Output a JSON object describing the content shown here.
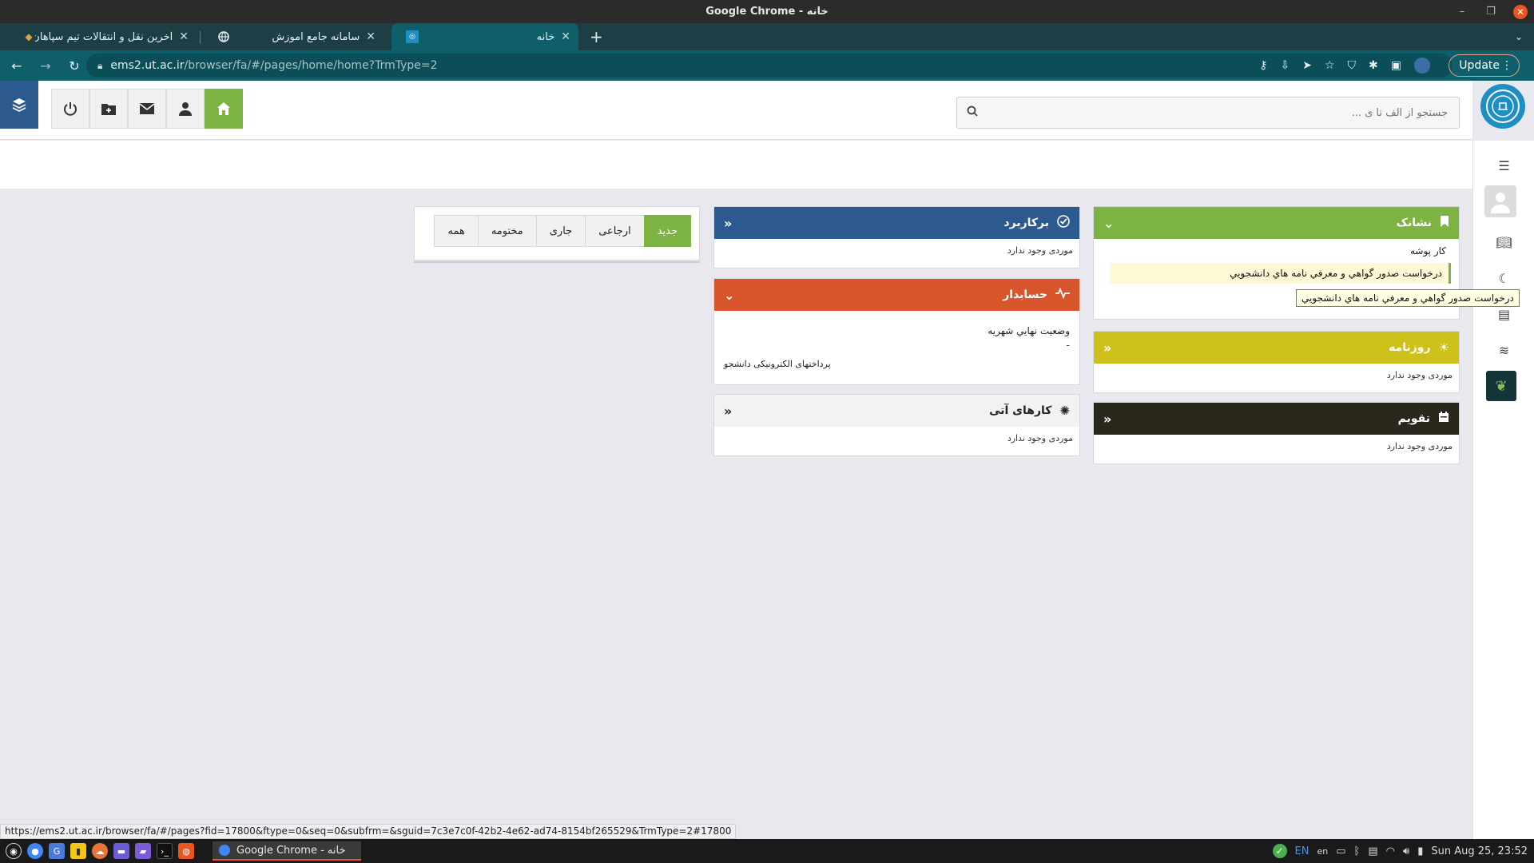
{
  "window": {
    "title": "Google Chrome - خانه",
    "minimize": "–",
    "maximize": "❐",
    "close": "✕"
  },
  "tabs": [
    {
      "title": "آخرین نقل و انتقالات تیم سپاهان",
      "close": "✕"
    },
    {
      "title": "سامانه جامع آموزش",
      "close": "✕"
    },
    {
      "title": "خانه",
      "close": "✕"
    }
  ],
  "new_tab": "+",
  "tab_menu": "⌄",
  "address": {
    "host": "ems2.ut.ac.ir",
    "path": "/browser/fa/#/pages/home/home?TrmType=2"
  },
  "update_button": "Update",
  "search": {
    "placeholder": "جستجو از الف تا ی ..."
  },
  "icons": {
    "layers": "layers-icon",
    "power": "power-icon",
    "folder_add": "folder-add-icon",
    "mail": "mail-icon",
    "user": "user-icon",
    "home": "home-icon",
    "search": "search-icon"
  },
  "colors": {
    "green": "#7cb342",
    "blue": "#2d5a8e",
    "orange": "#d9562c",
    "mustard": "#cdc01a",
    "dark": "#2a281c",
    "browser_teal": "#0f5f6b"
  },
  "panels": {
    "bookmarks": {
      "title": "نشانک",
      "folder": "کار پوشه",
      "item": "درخواست صدور گواهي و معرفي نامه هاي دانشجويي",
      "tooltip": "درخواست صدور گواهي و معرفي نامه هاي دانشجويي"
    },
    "journal": {
      "title": "روزنامه",
      "empty": "موردی وجود ندارد"
    },
    "calendar": {
      "title": "تقویم",
      "empty": "موردی وجود ندارد"
    },
    "applied": {
      "title": "برکاربرد",
      "empty": "موردی وجود ندارد"
    },
    "accounting": {
      "title": "حسابدار",
      "line1": "وضعيت نهايي شهريه",
      "dash": "-",
      "link": "پرداختهای الکترونیکی دانشجو"
    },
    "upcoming": {
      "title": "کارهای آتی",
      "empty": "موردی وجود ندارد"
    }
  },
  "filter_tabs": [
    "جدید",
    "ارجاعی",
    "جاری",
    "مختومه",
    "همه"
  ],
  "status_url": "https://ems2.ut.ac.ir/browser/fa/#/pages?fid=17800&ftype=0&seq=0&subfrm=&sguid=7c3e7c0f-42b2-4e62-ad74-8154bf265529&TrmType=2#17800",
  "taskbar": {
    "window_label": "Google Chrome - خانه",
    "lang_en": "EN",
    "lang": "en",
    "clock": "Sun Aug 25, 23:52"
  }
}
